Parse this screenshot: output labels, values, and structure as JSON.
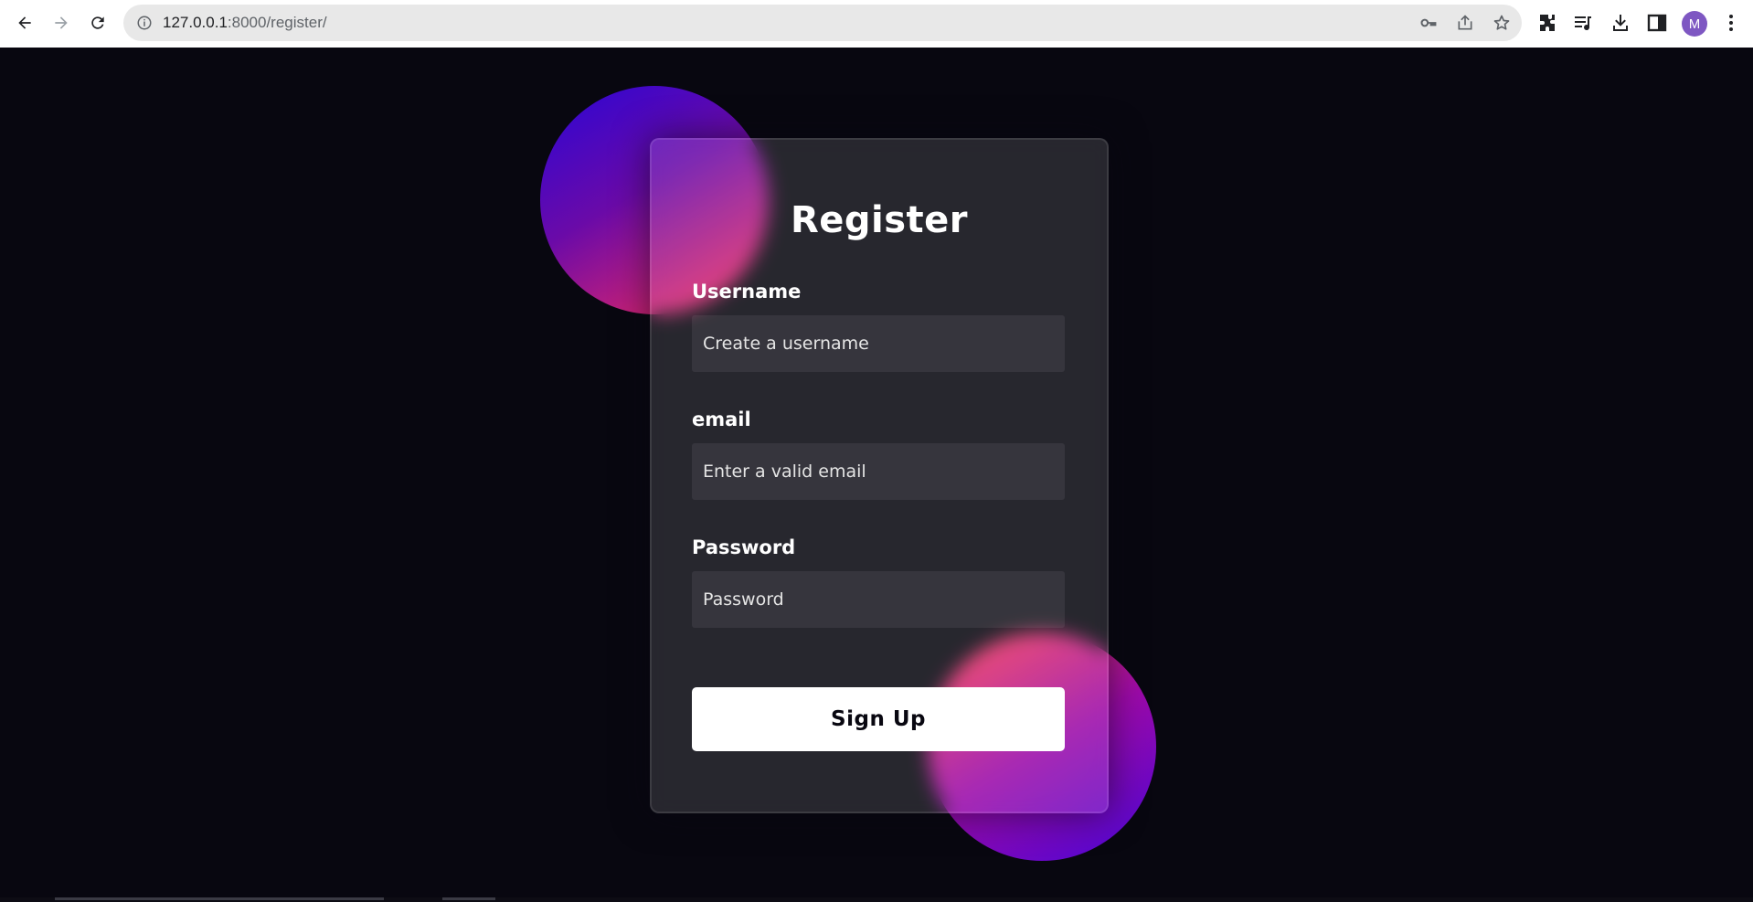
{
  "browser": {
    "url_host": "127.0.0.1",
    "url_path": ":8000/register/",
    "profile_initial": "M",
    "icons": {
      "back": "arrow-left-icon",
      "forward": "arrow-right-icon",
      "reload": "reload-icon",
      "site_info": "info-icon",
      "passwords": "key-icon",
      "share": "share-icon",
      "bookmark": "star-icon",
      "extensions": "puzzle-icon",
      "media": "media-queue-icon",
      "downloads": "download-icon",
      "side_panel": "side-panel-icon",
      "menu": "kebab-menu-icon"
    }
  },
  "form": {
    "title": "Register",
    "username": {
      "label": "Username",
      "placeholder": "Create a username"
    },
    "email": {
      "label": "email",
      "placeholder": "Enter a valid email"
    },
    "password": {
      "label": "Password",
      "placeholder": "Password"
    },
    "submit_label": "Sign Up"
  },
  "colors": {
    "background": "#080710",
    "button": "#ffffff",
    "blob_gradient_start": "#2b05d6",
    "blob_gradient_end": "#ff2e5a"
  }
}
